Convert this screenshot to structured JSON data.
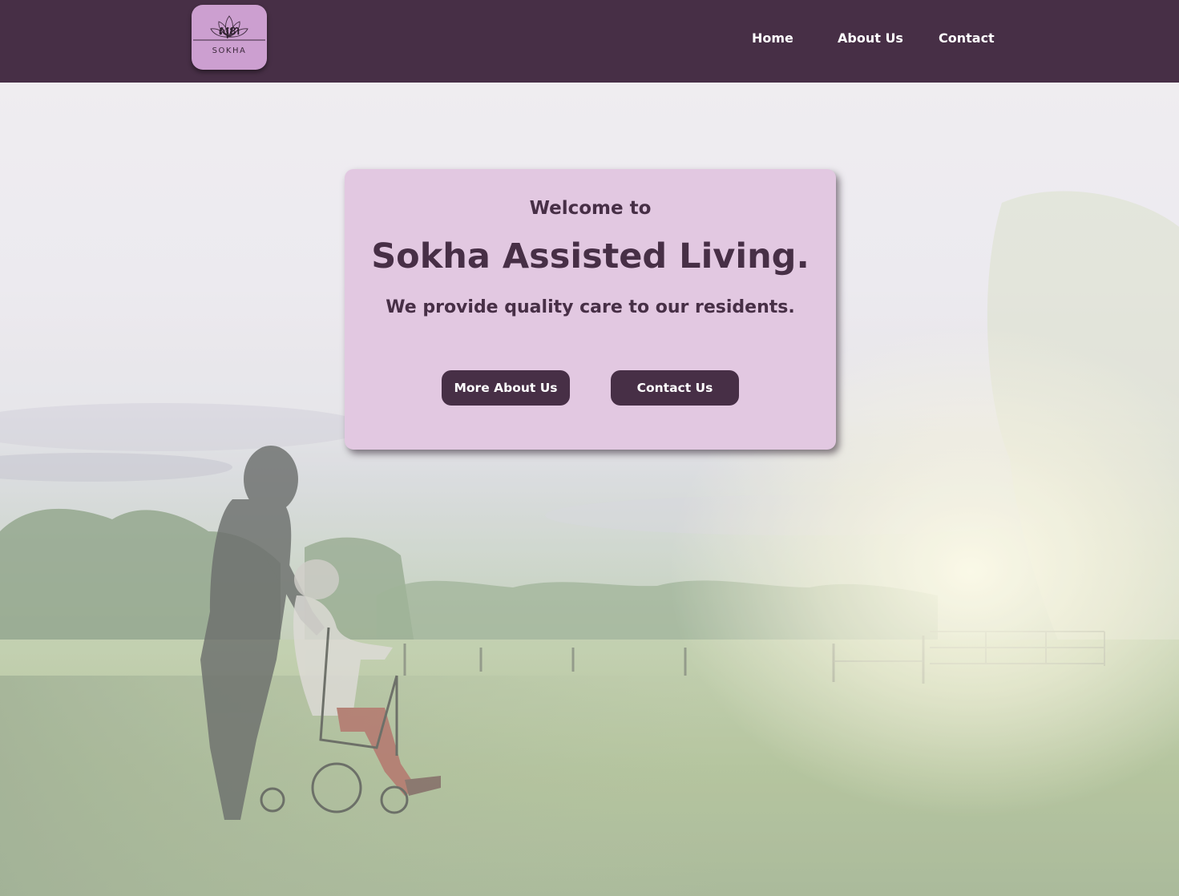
{
  "header": {
    "logo": {
      "script_text": "សុខា",
      "name_text": "SOKHA",
      "icon": "lotus-icon"
    },
    "nav": [
      {
        "label": "Home"
      },
      {
        "label": "About Us"
      },
      {
        "label": "Contact"
      }
    ]
  },
  "hero": {
    "pretitle": "Welcome to",
    "title": "Sokha Assisted Living.",
    "subtitle": "We provide quality care to our residents.",
    "buttons": {
      "about": "More About Us",
      "contact": "Contact Us"
    }
  },
  "colors": {
    "brand_dark": "#472f46",
    "card_bg": "#e2c8e1",
    "logo_bg": "#cc9fd0",
    "nav_text": "#ffffff"
  }
}
